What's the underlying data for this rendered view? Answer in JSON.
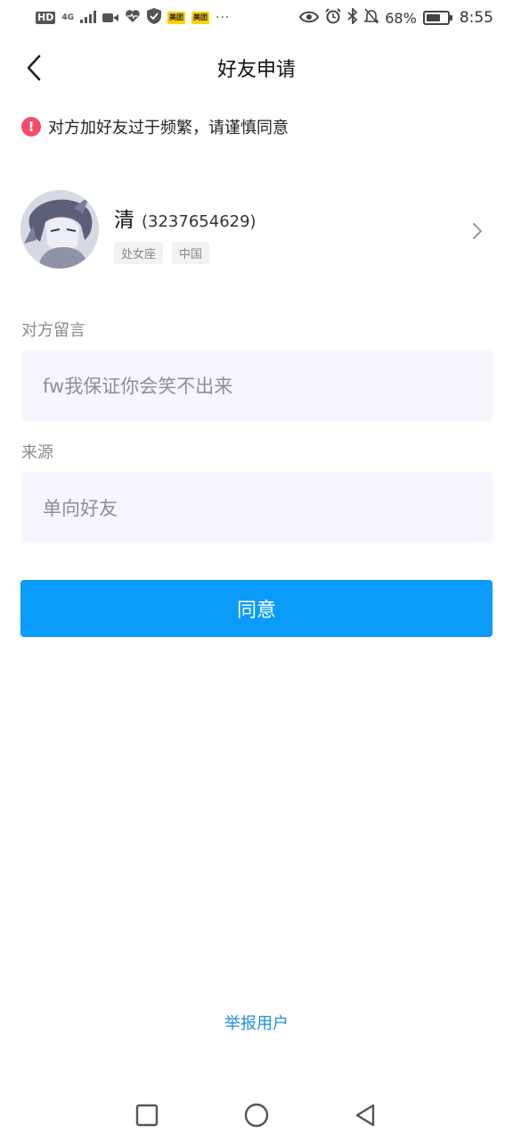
{
  "status_bar": {
    "hd": "HD",
    "network": "4G",
    "badge1": "美团",
    "badge2": "美团",
    "more": "···",
    "battery_percent": "68%",
    "battery_level": 0.68,
    "time": "8:55"
  },
  "header": {
    "title": "好友申请",
    "back_icon": "chevron-left-icon"
  },
  "warning": {
    "icon": "exclamation-icon",
    "text": "对方加好友过于频繁，请谨慎同意",
    "color": "#f74c6a"
  },
  "profile": {
    "name": "清",
    "uid": "(3237654629)",
    "tags": [
      "处女座",
      "中国"
    ]
  },
  "message": {
    "label": "对方留言",
    "value": "fw我保证你会笑不出来"
  },
  "source": {
    "label": "来源",
    "value": "单向好友"
  },
  "actions": {
    "agree_label": "同意",
    "agree_color": "#0a9bfb",
    "report_label": "举报用户"
  },
  "nav": {
    "recent_icon": "square-icon",
    "home_icon": "circle-icon",
    "back_icon": "triangle-back-icon"
  }
}
